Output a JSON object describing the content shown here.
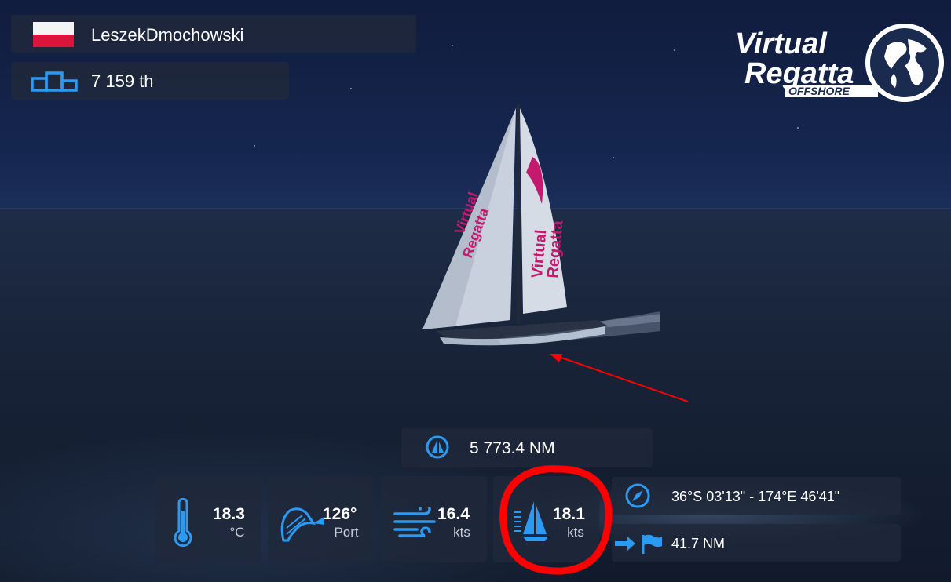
{
  "player": {
    "name": "LeszekDmochowski"
  },
  "ranking": {
    "position": "7 159 th"
  },
  "distance": {
    "value": "5 773.4 NM"
  },
  "stats": {
    "temperature": {
      "value": "18.3",
      "unit": "°C"
    },
    "heading": {
      "value": "126°",
      "tack": "Port"
    },
    "wind_speed": {
      "value": "16.4",
      "unit": "kts"
    },
    "boat_speed": {
      "value": "18.1",
      "unit": "kts"
    }
  },
  "position": {
    "coordinates": "36°S 03'13\" - 174°E 46'41\""
  },
  "waypoint": {
    "distance": "41.7 NM"
  },
  "logo": {
    "line1": "Virtual",
    "line2": "Regatta",
    "line3": "OFFSHORE"
  },
  "sail_branding": {
    "line1": "Virtual",
    "line2": "Regatta"
  },
  "colors": {
    "accent_blue": "#2b9af3",
    "annotation_red": "#ff0000",
    "sail_magenta": "#c4196d"
  },
  "icons": {
    "flag": "poland-flag-icon",
    "rank": "podium-icon",
    "distance": "boat-circle-icon",
    "temperature": "thermometer-icon",
    "heading": "sail-heading-icon",
    "wind": "wind-icon",
    "speed": "sailboat-icon",
    "position": "compass-icon",
    "waypoint": "arrow-flag-icon"
  }
}
